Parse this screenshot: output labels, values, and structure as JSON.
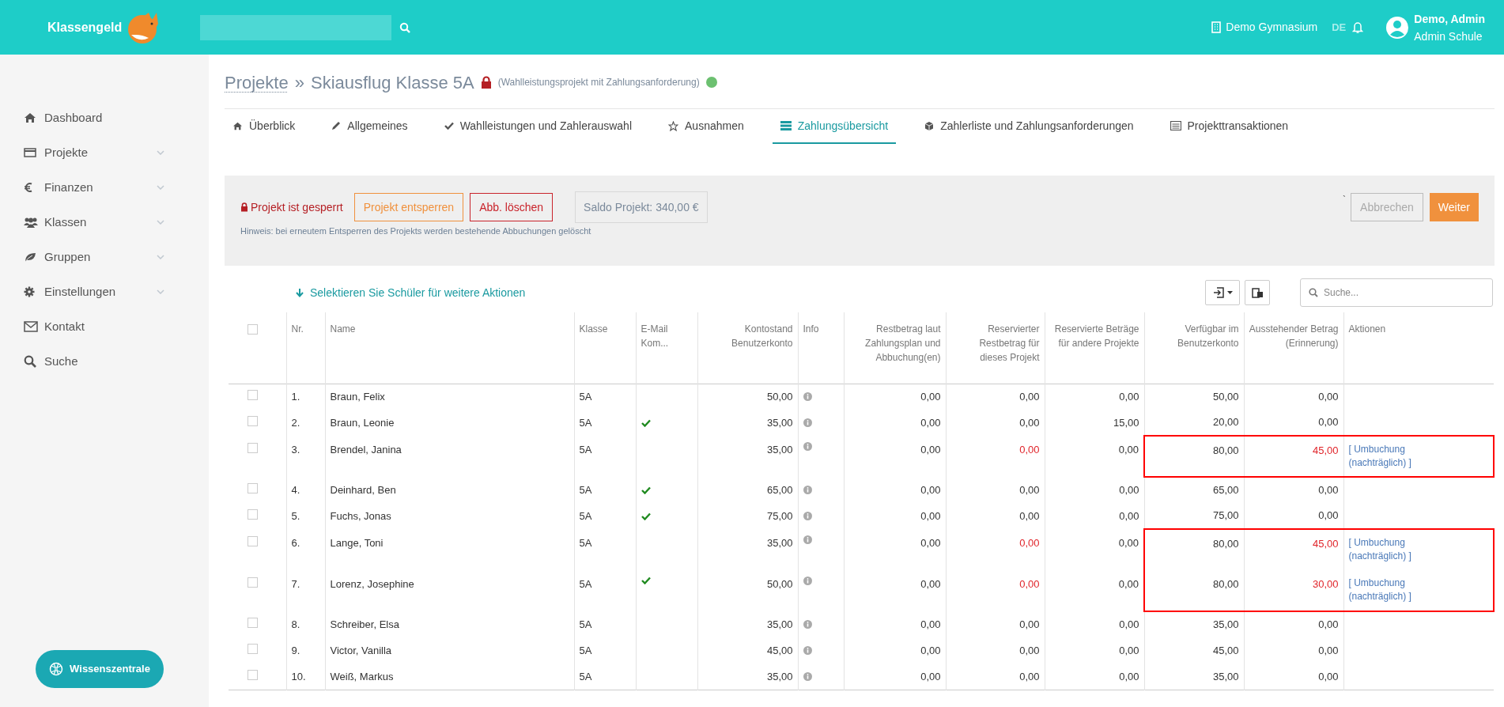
{
  "header": {
    "logo": "Klassengeld",
    "school": "Demo Gymnasium",
    "language": {
      "label": "DE",
      "selected": true
    },
    "user_name": "Demo, Admin",
    "user_role": "Admin Schule"
  },
  "sidebar": {
    "items": [
      {
        "label": "Dashboard",
        "expandable": false
      },
      {
        "label": "Projekte",
        "expandable": true
      },
      {
        "label": "Finanzen",
        "expandable": true
      },
      {
        "label": "Klassen",
        "expandable": true
      },
      {
        "label": "Gruppen",
        "expandable": true
      },
      {
        "label": "Einstellungen",
        "expandable": true
      },
      {
        "label": "Kontakt",
        "expandable": false
      },
      {
        "label": "Suche",
        "expandable": false
      }
    ],
    "help_button": "Wissenszentrale"
  },
  "breadcrumb": {
    "parent": "Projekte",
    "separator": "»",
    "title": "Skiausflug Klasse 5A",
    "locked": true,
    "project_type": "(Wahlleistungsprojekt mit Zahlungsanforderung)",
    "active": true
  },
  "tabs": [
    {
      "label": "Überblick",
      "selected": false
    },
    {
      "label": "Allgemeines",
      "selected": false
    },
    {
      "label": "Wahlleistungen und Zahlerauswahl",
      "selected": false
    },
    {
      "label": "Ausnahmen",
      "selected": false
    },
    {
      "label": "Zahlungsübersicht",
      "selected": true
    },
    {
      "label": "Zahlerliste und Zahlungsanforderungen",
      "selected": false
    },
    {
      "label": "Projekttransaktionen",
      "selected": false
    }
  ],
  "lock_panel": {
    "status": "Projekt ist gesperrt",
    "unlock_button": "Projekt entsperren",
    "delete_button": "Abb. löschen",
    "balance": "Saldo Projekt: 340,00 €",
    "hint": "Hinweis: bei erneutem Entsperren des Projekts werden bestehende Abbuchungen gelöscht",
    "mark": "`",
    "cancel_button": "Abbrechen",
    "cancel_disabled": true,
    "next_button": "Weiter"
  },
  "toolbar": {
    "select_hint": "Selektieren Sie Schüler für weitere Aktionen",
    "search_placeholder": "Suche..."
  },
  "table": {
    "all_checked": false,
    "columns": [
      "Nr.",
      "Name",
      "Klasse",
      "E-Mail Kom...",
      "Kontostand Benutzerkonto",
      "Info",
      "Restbetrag laut Zahlungsplan und Abbuchung(en)",
      "Reservierter Restbetrag für dieses Projekt",
      "Reservierte Beträge für andere Projekte",
      "Verfügbar im Benutzerkonto",
      "Ausstehender Betrag (Erinnerung)",
      "Aktionen"
    ],
    "rows": [
      {
        "checked": false,
        "nr": "1.",
        "name": "Braun, Felix",
        "class": "5A",
        "email": false,
        "balance": "50,00",
        "remaining": "0,00",
        "reserved": "0,00",
        "reserved_other": "0,00",
        "available": "50,00",
        "outstanding": "0,00",
        "flagged": false
      },
      {
        "checked": false,
        "nr": "2.",
        "name": "Braun, Leonie",
        "class": "5A",
        "email": true,
        "balance": "35,00",
        "remaining": "0,00",
        "reserved": "0,00",
        "reserved_other": "15,00",
        "available": "20,00",
        "outstanding": "0,00",
        "flagged": false
      },
      {
        "checked": false,
        "nr": "3.",
        "name": "Brendel, Janina",
        "class": "5A",
        "email": false,
        "balance": "35,00",
        "remaining": "0,00",
        "reserved": "0,00",
        "reserved_other": "0,00",
        "available": "80,00",
        "outstanding": "45,00",
        "flagged": true,
        "action": "[ Umbuchung (nachträglich) ]"
      },
      {
        "checked": false,
        "nr": "4.",
        "name": "Deinhard, Ben",
        "class": "5A",
        "email": true,
        "balance": "65,00",
        "remaining": "0,00",
        "reserved": "0,00",
        "reserved_other": "0,00",
        "available": "65,00",
        "outstanding": "0,00",
        "flagged": false
      },
      {
        "checked": false,
        "nr": "5.",
        "name": "Fuchs, Jonas",
        "class": "5A",
        "email": true,
        "balance": "75,00",
        "remaining": "0,00",
        "reserved": "0,00",
        "reserved_other": "0,00",
        "available": "75,00",
        "outstanding": "0,00",
        "flagged": false
      },
      {
        "checked": false,
        "nr": "6.",
        "name": "Lange, Toni",
        "class": "5A",
        "email": false,
        "balance": "35,00",
        "remaining": "0,00",
        "reserved": "0,00",
        "reserved_other": "0,00",
        "available": "80,00",
        "outstanding": "45,00",
        "flagged": true,
        "action": "[ Umbuchung (nachträglich) ]"
      },
      {
        "checked": false,
        "nr": "7.",
        "name": "Lorenz, Josephine",
        "class": "5A",
        "email": true,
        "balance": "50,00",
        "remaining": "0,00",
        "reserved": "0,00",
        "reserved_other": "0,00",
        "available": "80,00",
        "outstanding": "30,00",
        "flagged": true,
        "action": "[ Umbuchung (nachträglich) ]"
      },
      {
        "checked": false,
        "nr": "8.",
        "name": "Schreiber, Elsa",
        "class": "5A",
        "email": false,
        "balance": "35,00",
        "remaining": "0,00",
        "reserved": "0,00",
        "reserved_other": "0,00",
        "available": "35,00",
        "outstanding": "0,00",
        "flagged": false
      },
      {
        "checked": false,
        "nr": "9.",
        "name": "Victor, Vanilla",
        "class": "5A",
        "email": false,
        "balance": "45,00",
        "remaining": "0,00",
        "reserved": "0,00",
        "reserved_other": "0,00",
        "available": "45,00",
        "outstanding": "0,00",
        "flagged": false
      },
      {
        "checked": false,
        "nr": "10.",
        "name": "Weiß, Markus",
        "class": "5A",
        "email": false,
        "balance": "35,00",
        "remaining": "0,00",
        "reserved": "0,00",
        "reserved_other": "0,00",
        "available": "35,00",
        "outstanding": "0,00",
        "flagged": false
      }
    ]
  }
}
